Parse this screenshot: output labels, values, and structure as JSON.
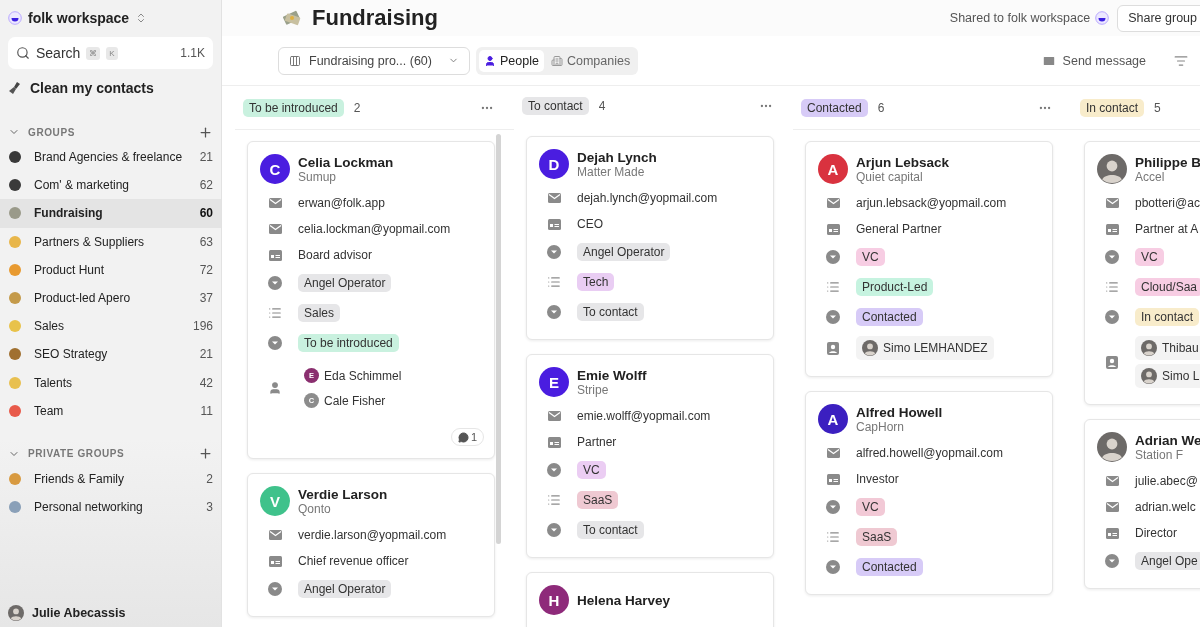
{
  "sidebar": {
    "workspace": "folk workspace",
    "search": {
      "placeholder": "Search",
      "keys": [
        "⌘",
        "K"
      ],
      "count": "1.1K"
    },
    "clean": "Clean my contacts",
    "sections": [
      {
        "title": "GROUPS",
        "items": [
          {
            "label": "Brand Agencies & freelance",
            "count": "21",
            "selected": false,
            "color": "#3a3a3a"
          },
          {
            "label": "Com' & marketing",
            "count": "62",
            "selected": false,
            "color": "#3a3a3a"
          },
          {
            "label": "Fundraising",
            "count": "60",
            "selected": true,
            "color": "#9a9a8a"
          },
          {
            "label": "Partners & Suppliers",
            "count": "63",
            "selected": false,
            "color": "#e8b64a"
          },
          {
            "label": "Product Hunt",
            "count": "72",
            "selected": false,
            "color": "#e89a30"
          },
          {
            "label": "Product-led Apero",
            "count": "37",
            "selected": false,
            "color": "#c49a4a"
          },
          {
            "label": "Sales",
            "count": "196",
            "selected": false,
            "color": "#e8c24a"
          },
          {
            "label": "SEO Strategy",
            "count": "21",
            "selected": false,
            "color": "#a07030"
          },
          {
            "label": "Talents",
            "count": "42",
            "selected": false,
            "color": "#e8c050"
          },
          {
            "label": "Team",
            "count": "11",
            "selected": false,
            "color": "#e85a4a"
          }
        ]
      },
      {
        "title": "PRIVATE GROUPS",
        "items": [
          {
            "label": "Friends & Family",
            "count": "2",
            "selected": false,
            "color": "#d89a40"
          },
          {
            "label": "Personal networking",
            "count": "3",
            "selected": false,
            "color": "#8aa0b8"
          }
        ]
      }
    ],
    "user": "Julie Abecassis"
  },
  "header": {
    "title": "Fundraising",
    "shared": "Shared to folk workspace",
    "share_button": "Share group"
  },
  "toolbar": {
    "view": "Fundraising pro... (60)",
    "tabs": [
      {
        "label": "People",
        "selected": true
      },
      {
        "label": "Companies",
        "selected": false
      }
    ],
    "send": "Send message"
  },
  "columns": [
    {
      "title": "To be introduced",
      "color": "#c9f1df",
      "count": "2",
      "menu": true,
      "cards": [
        {
          "name": "Celia Lockman",
          "company": "Sumup",
          "avatar": {
            "kind": "letter",
            "letter": "C",
            "color": "#4a1de0"
          },
          "comments": "1",
          "fields": [
            {
              "kind": "email",
              "value": "erwan@folk.app"
            },
            {
              "kind": "email",
              "value": "celia.lockman@yopmail.com"
            },
            {
              "kind": "job",
              "value": "Board advisor"
            },
            {
              "kind": "tag",
              "tags": [
                {
                  "label": "Angel Operator",
                  "color": "#e6e6e8"
                }
              ]
            },
            {
              "kind": "list",
              "tags": [
                {
                  "label": "Sales",
                  "color": "#e6e6e8"
                }
              ]
            },
            {
              "kind": "tag",
              "tags": [
                {
                  "label": "To be introduced",
                  "color": "#c9f1df"
                }
              ]
            },
            {
              "kind": "people",
              "people": [
                {
                  "letter": "E",
                  "color": "#8a2f6f",
                  "name": "Eda Schimmel"
                },
                {
                  "letter": "C",
                  "color": "#8c8c8c",
                  "name": "Cale Fisher"
                }
              ]
            }
          ]
        },
        {
          "name": "Verdie Larson",
          "company": "Qonto",
          "avatar": {
            "kind": "letter",
            "letter": "V",
            "color": "#3fc28b"
          },
          "fields": [
            {
              "kind": "email",
              "value": "verdie.larson@yopmail.com"
            },
            {
              "kind": "job",
              "value": "Chief revenue officer"
            },
            {
              "kind": "tag",
              "tags": [
                {
                  "label": "Angel Operator",
                  "color": "#e6e6e8"
                }
              ]
            }
          ]
        }
      ]
    },
    {
      "title": "To contact",
      "color": "#e6e6e8",
      "count": "4",
      "menu": true,
      "cards": [
        {
          "name": "Dejah Lynch",
          "company": "Matter Made",
          "avatar": {
            "kind": "letter",
            "letter": "D",
            "color": "#4a1de0"
          },
          "fields": [
            {
              "kind": "email",
              "value": "dejah.lynch@yopmail.com"
            },
            {
              "kind": "job",
              "value": "CEO"
            },
            {
              "kind": "tag",
              "tags": [
                {
                  "label": "Angel Operator",
                  "color": "#e6e6e8"
                }
              ]
            },
            {
              "kind": "list",
              "tags": [
                {
                  "label": "Tech",
                  "color": "#e9cdf3"
                }
              ]
            },
            {
              "kind": "tag",
              "tags": [
                {
                  "label": "To contact",
                  "color": "#e6e6e8"
                }
              ]
            }
          ]
        },
        {
          "name": "Emie Wolff",
          "company": "Stripe",
          "avatar": {
            "kind": "letter",
            "letter": "E",
            "color": "#4a1de0"
          },
          "fields": [
            {
              "kind": "email",
              "value": "emie.wolff@yopmail.com"
            },
            {
              "kind": "job",
              "value": "Partner"
            },
            {
              "kind": "tag",
              "tags": [
                {
                  "label": "VC",
                  "color": "#ebcdf3"
                }
              ]
            },
            {
              "kind": "list",
              "tags": [
                {
                  "label": "SaaS",
                  "color": "#efc9d2"
                }
              ]
            },
            {
              "kind": "tag",
              "tags": [
                {
                  "label": "To contact",
                  "color": "#e6e6e8"
                }
              ]
            }
          ]
        },
        {
          "name": "Helena Harvey",
          "avatar": {
            "kind": "letter",
            "letter": "H",
            "color": "#8e2a7a"
          }
        }
      ]
    },
    {
      "title": "Contacted",
      "color": "#d7cbf7",
      "count": "6",
      "menu": true,
      "cards": [
        {
          "name": "Arjun Lebsack",
          "company": "Quiet capital",
          "avatar": {
            "kind": "letter",
            "letter": "A",
            "color": "#d9323f"
          },
          "fields": [
            {
              "kind": "email",
              "value": "arjun.lebsack@yopmail.com"
            },
            {
              "kind": "job",
              "value": "General Partner"
            },
            {
              "kind": "tag",
              "tags": [
                {
                  "label": "VC",
                  "color": "#f7cde3"
                }
              ]
            },
            {
              "kind": "list",
              "tags": [
                {
                  "label": "Product-Led",
                  "color": "#c6f3e0"
                }
              ]
            },
            {
              "kind": "tag",
              "tags": [
                {
                  "label": "Contacted",
                  "color": "#d7cbf7"
                }
              ]
            },
            {
              "kind": "owner",
              "people": [
                {
                  "name": "Simo LEMHANDEZ"
                }
              ]
            }
          ]
        },
        {
          "name": "Alfred Howell",
          "company": "CapHorn",
          "avatar": {
            "kind": "letter",
            "letter": "A",
            "color": "#3b1fc0"
          },
          "fields": [
            {
              "kind": "email",
              "value": "alfred.howell@yopmail.com"
            },
            {
              "kind": "job",
              "value": "Investor"
            },
            {
              "kind": "tag",
              "tags": [
                {
                  "label": "VC",
                  "color": "#f2c9d6"
                }
              ]
            },
            {
              "kind": "list",
              "tags": [
                {
                  "label": "SaaS",
                  "color": "#efc9d2"
                }
              ]
            },
            {
              "kind": "tag",
              "tags": [
                {
                  "label": "Contacted",
                  "color": "#d7cbf7"
                }
              ]
            }
          ]
        }
      ]
    },
    {
      "title": "In contact",
      "color": "#f8eccb",
      "count": "5",
      "menu": false,
      "cards": [
        {
          "name": "Philippe B",
          "company": "Accel",
          "avatar": {
            "kind": "photo"
          },
          "fields": [
            {
              "kind": "email",
              "value": "pbotteri@ac"
            },
            {
              "kind": "job",
              "value": "Partner at A"
            },
            {
              "kind": "tag",
              "tags": [
                {
                  "label": "VC",
                  "color": "#f7cde3"
                }
              ]
            },
            {
              "kind": "list",
              "tags": [
                {
                  "label": "Cloud/Saa",
                  "color": "#f7cde3"
                }
              ]
            },
            {
              "kind": "tag",
              "tags": [
                {
                  "label": "In contact",
                  "color": "#f8eccb"
                }
              ]
            },
            {
              "kind": "owner",
              "people": [
                {
                  "name": "Thibau"
                },
                {
                  "name": "Simo L"
                }
              ]
            }
          ]
        },
        {
          "name": "Adrian We",
          "company": "Station F",
          "avatar": {
            "kind": "photo"
          },
          "fields": [
            {
              "kind": "email",
              "value": "julie.abec@"
            },
            {
              "kind": "email",
              "value": "adrian.welc"
            },
            {
              "kind": "job",
              "value": "Director"
            },
            {
              "kind": "tag",
              "tags": [
                {
                  "label": "Angel Ope",
                  "color": "#e6e6e8"
                }
              ]
            }
          ]
        }
      ]
    }
  ]
}
